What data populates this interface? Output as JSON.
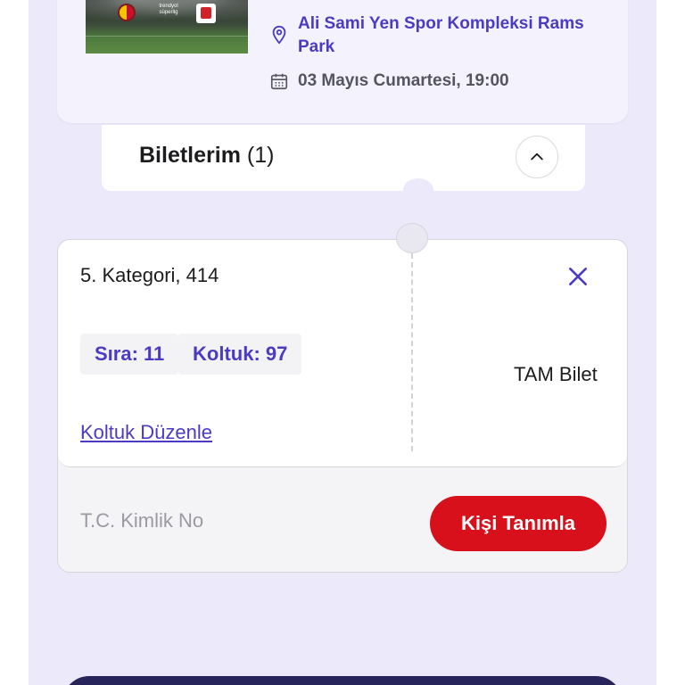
{
  "event": {
    "venue": "Ali Sami Yen Spor Kompleksi Rams Park",
    "date": "03 Mayıs Cumartesi, 19:00",
    "thumb_label": "trendyol süperlig"
  },
  "tickets_section": {
    "title": "Biletlerim",
    "count": "(1)"
  },
  "ticket": {
    "category": "5. Kategori, 414",
    "row": "Sıra: 11",
    "seat": "Koltuk: 97",
    "edit_link": "Koltuk Düzenle",
    "type": "TAM Bilet",
    "id_placeholder": "T.C. Kimlik No",
    "define_button": "Kişi Tanımla"
  },
  "colors": {
    "accent": "#4b3bc3",
    "primary_button": "#d8101b",
    "background": "#ebe9fa"
  },
  "icons": {
    "venue": "location-pin-icon",
    "date": "calendar-icon",
    "collapse": "chevron-up-icon",
    "remove": "close-icon"
  }
}
